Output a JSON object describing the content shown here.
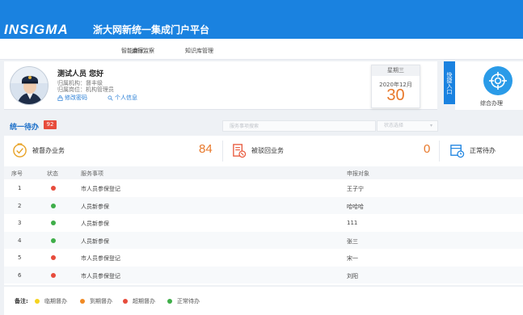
{
  "app": {
    "logo_text": "INSIGMA",
    "platform_title": "浙大网新统一集成门户平台"
  },
  "nav": {
    "tabs": [
      {
        "label": "智能商家"
      },
      {
        "label": "运行监察"
      },
      {
        "label": "知识库管理"
      }
    ]
  },
  "user": {
    "greeting": "测试人员 您好",
    "org_line": "归属机构：督丰级",
    "post_line": "归属岗位：机构管理员",
    "change_password": "修改密码",
    "personal_info": "个人信息"
  },
  "date": {
    "weekday": "星期三",
    "year_month": "2020年12月",
    "day": "30"
  },
  "quick_entry": {
    "label": "快捷入口",
    "portal_label": "综合办理"
  },
  "todo": {
    "title": "统一待办",
    "badge": "92",
    "search_placeholder": "服务事项搜索",
    "status_placeholder": "状态选择",
    "status_caret": "▾"
  },
  "stats": [
    {
      "label": "被督办业务",
      "count": "84",
      "icon": "supervised-icon"
    },
    {
      "label": "被驳回业务",
      "count": "0",
      "icon": "rejected-icon"
    },
    {
      "label": "正常待办",
      "count": "",
      "icon": "normal-todo-icon"
    }
  ],
  "table": {
    "headers": {
      "index": "序号",
      "status": "状态",
      "service": "服务事项",
      "applicant": "申报对象"
    },
    "rows": [
      {
        "index": "1",
        "status": "red",
        "service": "市人员参保登记",
        "applicant": "王子宁"
      },
      {
        "index": "2",
        "status": "green",
        "service": "人员新参保",
        "applicant": "哈哈哈"
      },
      {
        "index": "3",
        "status": "green",
        "service": "人员新参保",
        "applicant": "111"
      },
      {
        "index": "4",
        "status": "green",
        "service": "人员新参保",
        "applicant": "张三"
      },
      {
        "index": "5",
        "status": "red",
        "service": "市人员参保登记",
        "applicant": "宋一"
      },
      {
        "index": "6",
        "status": "red",
        "service": "市人员参保登记",
        "applicant": "刘阳"
      }
    ]
  },
  "legend": {
    "title": "备注:",
    "items": [
      {
        "label": "临期督办",
        "color": "#f5d31f"
      },
      {
        "label": "到期督办",
        "color": "#f08a24"
      },
      {
        "label": "超期督办",
        "color": "#e74c3c"
      },
      {
        "label": "正常待办",
        "color": "#3fae49"
      }
    ]
  },
  "colors": {
    "primary": "#1a82e0",
    "accent": "#e8782a",
    "red": "#e74c3c",
    "green": "#3fae49"
  }
}
